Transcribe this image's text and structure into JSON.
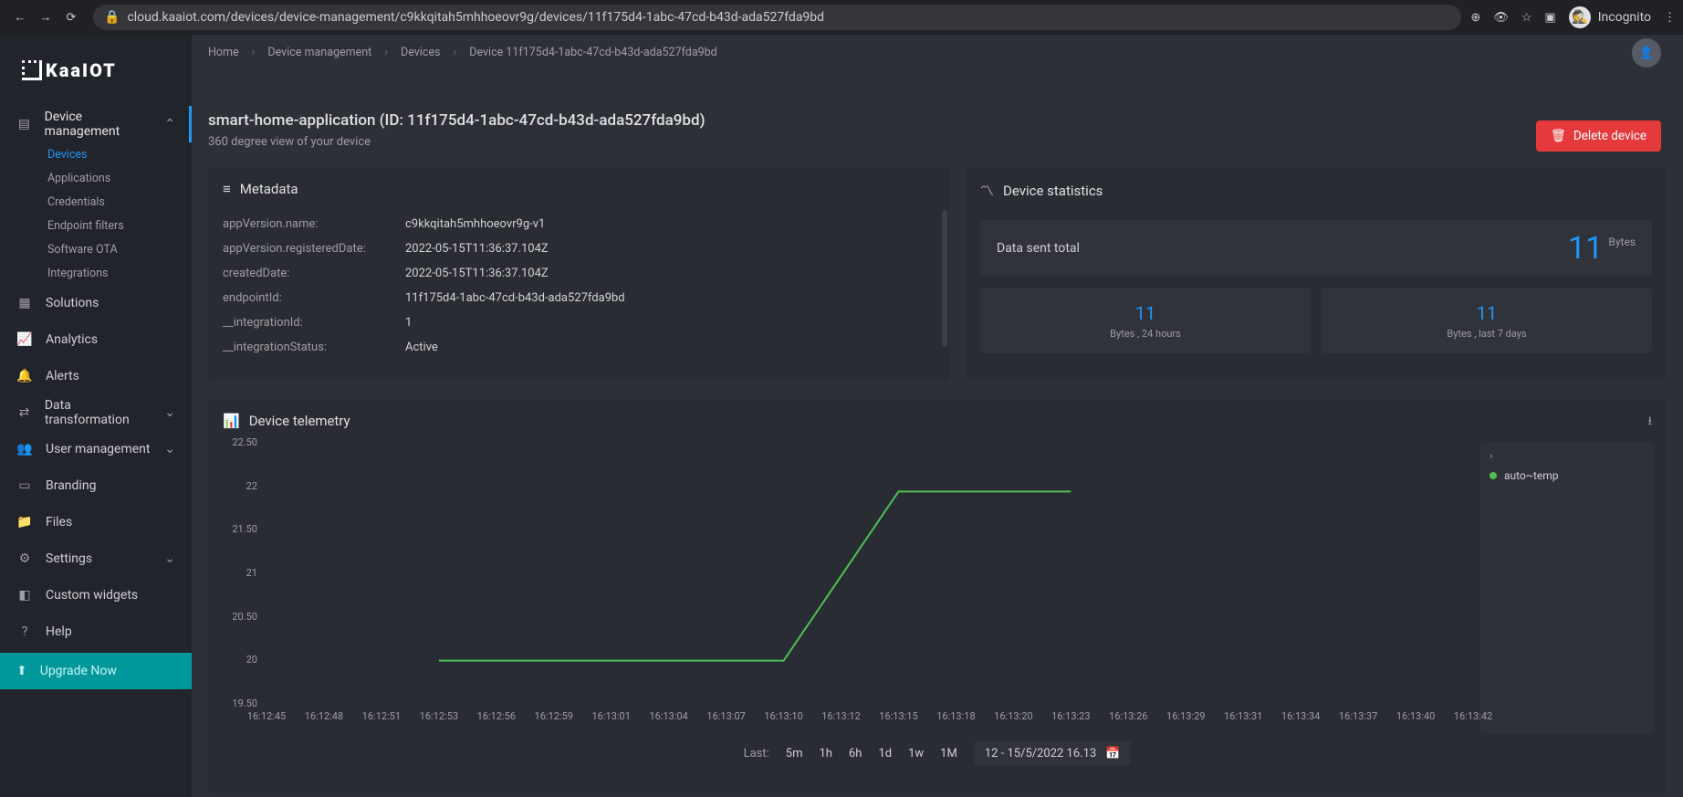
{
  "browser": {
    "url": "cloud.kaaiot.com/devices/device-management/c9kkqitah5mhhoeovr9g/devices/11f175d4-1abc-47cd-b43d-ada527fda9bd",
    "incognito": "Incognito"
  },
  "logo": "KaaIOT",
  "sidebar": {
    "device_management": "Device management",
    "subs": [
      "Devices",
      "Applications",
      "Credentials",
      "Endpoint filters",
      "Software OTA",
      "Integrations"
    ],
    "solutions": "Solutions",
    "analytics": "Analytics",
    "alerts": "Alerts",
    "data_transform": "Data transformation",
    "user_mgmt": "User management",
    "branding": "Branding",
    "files": "Files",
    "settings": "Settings",
    "custom_widgets": "Custom widgets",
    "help": "Help",
    "upgrade": "Upgrade Now"
  },
  "breadcrumbs": [
    "Home",
    "Device management",
    "Devices",
    "Device 11f175d4-1abc-47cd-b43d-ada527fda9bd"
  ],
  "page": {
    "title": "smart-home-application (ID: 11f175d4-1abc-47cd-b43d-ada527fda9bd)",
    "subtitle": "360 degree view of your device",
    "delete": "Delete device"
  },
  "metadata": {
    "title": "Metadata",
    "rows": [
      {
        "k": "appVersion.name:",
        "v": "c9kkqitah5mhhoeovr9g-v1"
      },
      {
        "k": "appVersion.registeredDate:",
        "v": "2022-05-15T11:36:37.104Z"
      },
      {
        "k": "createdDate:",
        "v": "2022-05-15T11:36:37.104Z"
      },
      {
        "k": "endpointId:",
        "v": "11f175d4-1abc-47cd-b43d-ada527fda9bd"
      },
      {
        "k": "__integrationId:",
        "v": "1"
      },
      {
        "k": "__integrationStatus:",
        "v": "Active"
      }
    ]
  },
  "stats": {
    "title": "Device statistics",
    "total_label": "Data sent total",
    "total_value": "11",
    "total_unit": "Bytes",
    "cells": [
      {
        "value": "11",
        "label": "Bytes , 24 hours"
      },
      {
        "value": "11",
        "label": "Bytes , last 7 days"
      }
    ]
  },
  "telemetry": {
    "title": "Device telemetry",
    "legend": "auto~temp",
    "range_label": "Last:",
    "range_opts": [
      "5m",
      "1h",
      "6h",
      "1d",
      "1w",
      "1M"
    ],
    "date_range": "12 - 15/5/2022 16.13"
  },
  "chart_data": {
    "type": "line",
    "ylabel": "",
    "ylim": [
      19.5,
      22.5
    ],
    "yticks": [
      19.5,
      20,
      20.5,
      21,
      21.5,
      22,
      22.5
    ],
    "x_categories": [
      "16:12:45",
      "16:12:48",
      "16:12:51",
      "16:12:53",
      "16:12:56",
      "16:12:59",
      "16:13:01",
      "16:13:04",
      "16:13:07",
      "16:13:10",
      "16:13:12",
      "16:13:15",
      "16:13:18",
      "16:13:20",
      "16:13:23",
      "16:13:26",
      "16:13:29",
      "16:13:31",
      "16:13:34",
      "16:13:37",
      "16:13:40",
      "16:13:42"
    ],
    "series": [
      {
        "name": "auto~temp",
        "color": "#4fbf55",
        "points": [
          {
            "x": "16:12:53",
            "y": 20
          },
          {
            "x": "16:13:10",
            "y": 20
          },
          {
            "x": "16:13:15",
            "y": 22
          },
          {
            "x": "16:13:23",
            "y": 22
          }
        ]
      }
    ]
  }
}
